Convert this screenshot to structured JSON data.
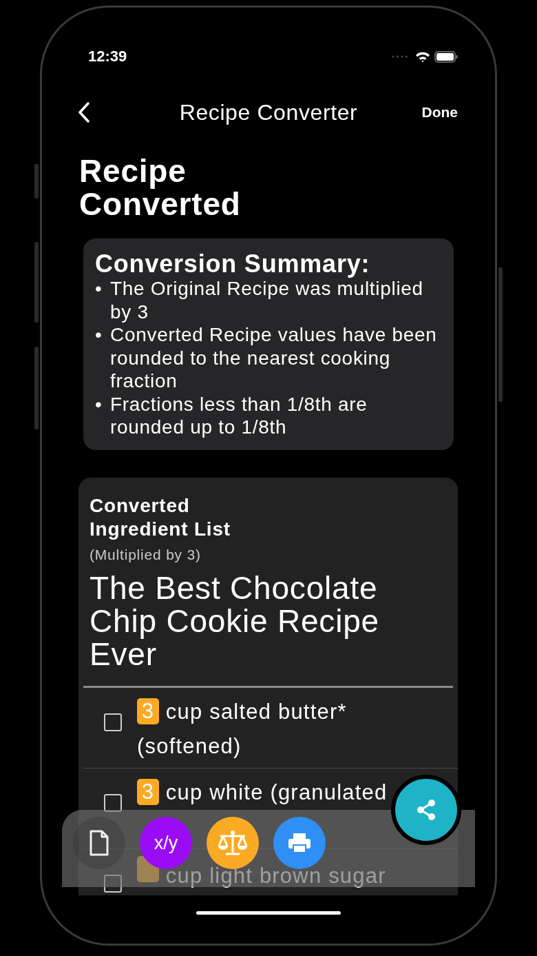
{
  "status_bar": {
    "time": "12:39"
  },
  "nav": {
    "title": "Recipe Converter",
    "done": "Done"
  },
  "page_title": "Recipe Converted",
  "summary": {
    "heading": "Conversion Summary:",
    "bullets": [
      {
        "marker": "•",
        "text": "The Original Recipe was multiplied by 3"
      },
      {
        "marker": "•",
        "text": "Converted Recipe values have been rounded to the nearest cooking fraction"
      },
      {
        "marker": "•",
        "text": "Fractions less than 1/8th are rounded up to 1/8th"
      }
    ]
  },
  "ingredients": {
    "heading": "Converted Ingredient List",
    "subheading": "(Multiplied by 3)",
    "recipe_title": "The Best Chocolate Chip Cookie Recipe Ever",
    "items": [
      {
        "amount": "3",
        "text": "cup salted butter* (softened)",
        "checked": false
      },
      {
        "amount": "3",
        "text": "cup white (granulated",
        "checked": false
      },
      {
        "text": "cup light brown sugar",
        "checked": false
      }
    ]
  },
  "toolbar": {
    "buttons": [
      {
        "kind": "document",
        "selected": true
      },
      {
        "kind": "fraction",
        "label": "x/y",
        "selected": false
      },
      {
        "kind": "scale",
        "selected": false
      },
      {
        "kind": "print",
        "selected": false
      }
    ]
  }
}
